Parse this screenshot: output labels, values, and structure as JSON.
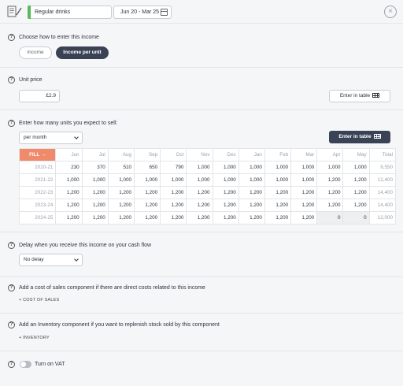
{
  "header": {
    "name_value": "Regular drinks",
    "date_range": "Jun 20 - Mar 25"
  },
  "entry_method": {
    "title": "Choose how to enter this income",
    "options": [
      "Income",
      "Income per unit"
    ],
    "selected": "Income per unit"
  },
  "unit_price": {
    "title": "Unit price",
    "value": "£2.9",
    "table_button": "Enter in table"
  },
  "units": {
    "title": "Enter how many units you expect to sell:",
    "period_select": "per month",
    "table_button": "Enter in table",
    "fill_label": "FILL →",
    "columns": [
      "Jun",
      "Jul",
      "Aug",
      "Sep",
      "Oct",
      "Nov",
      "Dec",
      "Jan",
      "Feb",
      "Mar",
      "Apr",
      "May",
      "Total"
    ],
    "rows": [
      {
        "year": "2020-21",
        "values": [
          "230",
          "370",
          "510",
          "650",
          "790",
          "1,000",
          "1,000",
          "1,000",
          "1,000",
          "1,000",
          "1,000",
          "1,000"
        ],
        "total": "9,550"
      },
      {
        "year": "2021-22",
        "values": [
          "1,000",
          "1,000",
          "1,000",
          "1,000",
          "1,000",
          "1,000",
          "1,000",
          "1,000",
          "1,000",
          "1,000",
          "1,200",
          "1,200"
        ],
        "total": "12,400"
      },
      {
        "year": "2022-23",
        "values": [
          "1,200",
          "1,200",
          "1,200",
          "1,200",
          "1,200",
          "1,200",
          "1,200",
          "1,200",
          "1,200",
          "1,200",
          "1,200",
          "1,200"
        ],
        "total": "14,400"
      },
      {
        "year": "2023-24",
        "values": [
          "1,200",
          "1,200",
          "1,200",
          "1,200",
          "1,200",
          "1,200",
          "1,200",
          "1,200",
          "1,200",
          "1,200",
          "1,200",
          "1,200"
        ],
        "total": "14,400"
      },
      {
        "year": "2024-25",
        "values": [
          "1,200",
          "1,200",
          "1,200",
          "1,200",
          "1,200",
          "1,200",
          "1,200",
          "1,200",
          "1,200",
          "1,200",
          "0",
          "0"
        ],
        "total": "12,000"
      }
    ]
  },
  "delay": {
    "title": "Delay when you receive this income on your cash flow",
    "select_value": "No delay"
  },
  "cost_of_sales": {
    "title": "Add a cost of sales component if there are direct costs related to this income",
    "link": "+ COST OF SALES"
  },
  "inventory": {
    "title": "Add an Inventory component if you want to replenish stock sold by this component",
    "link": "+ INVENTORY"
  },
  "vat": {
    "label": "Turn on VAT",
    "enabled": false
  },
  "colors": {
    "accent_dark": "#3a4256",
    "fill_orange": "#f08a6b",
    "name_green": "#59b859"
  }
}
